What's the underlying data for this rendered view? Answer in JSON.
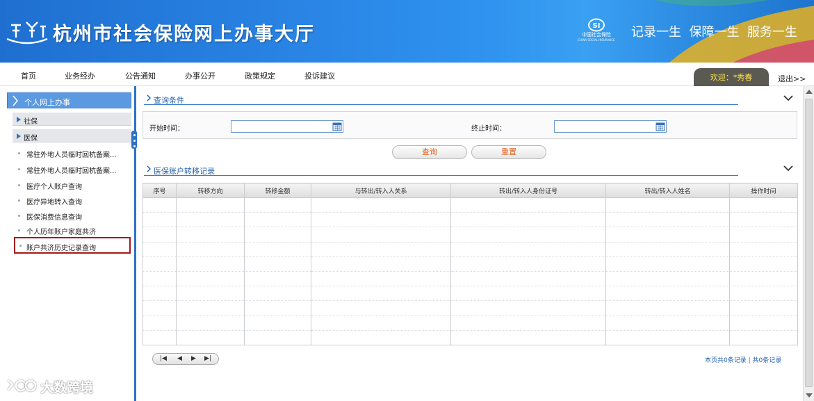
{
  "header": {
    "site_title": "杭州市社会保险网上办事大厅",
    "si_logo_cn": "中国社会保险",
    "si_logo_en": "CHINA SOCIAL INSURANCE",
    "slogan": "记录一生  保障一生  服务一生"
  },
  "nav": {
    "items": [
      "首页",
      "业务经办",
      "公告通知",
      "办事公开",
      "政策规定",
      "投诉建议"
    ],
    "welcome": "欢迎：*秀春",
    "logout": "退出>>"
  },
  "sidebar": {
    "title": "个人网上办事",
    "groups": [
      "社保",
      "医保"
    ],
    "items": [
      "常驻外地人员临时回杭备案...",
      "常驻外地人员临时回杭备案...",
      "医疗个人账户查询",
      "医疗异地转入查询",
      "医保消费信息查询",
      "个人历年账户家庭共济",
      "账户共济历史记录查询"
    ],
    "highlighted_index": 6
  },
  "query": {
    "section_title": "查询条件",
    "start_label": "开始时间：",
    "end_label": "终止时间：",
    "start_value": "",
    "end_value": "",
    "query_button": "查询",
    "reset_button": "重置"
  },
  "records": {
    "section_title": "医保账户转移记录",
    "columns": [
      "序号",
      "转移方向",
      "转移金额",
      "与转出/转入人关系",
      "转出/转入人身份证号",
      "转出/转入人姓名",
      "操作时间"
    ],
    "rows": [],
    "pager": {
      "first": "|◀",
      "prev": "◀",
      "next": "▶",
      "last": "▶|"
    },
    "count_text": "本页共0条记录 | 共0条记录"
  },
  "watermark": {
    "text": "大数跨境"
  },
  "colors": {
    "accent_blue": "#2b73c8",
    "highlight_red": "#a9171b",
    "button_text": "#e0601a",
    "welcome_text": "#ffe04a"
  }
}
